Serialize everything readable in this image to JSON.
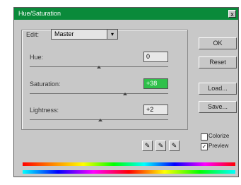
{
  "window": {
    "title": "Hue/Saturation",
    "close_label": "x"
  },
  "edit": {
    "label": "Edit:",
    "value": "Master",
    "arrow": "▾"
  },
  "sliders": [
    {
      "label": "Hue:",
      "value": "0",
      "level": 0.5
    },
    {
      "label": "Saturation:",
      "value": "+38",
      "level": 0.69
    },
    {
      "label": "Lightness:",
      "value": "+2",
      "level": 0.51
    }
  ],
  "buttons": {
    "ok": "OK",
    "reset": "Reset",
    "load": "Load...",
    "save": "Save..."
  },
  "eyedroppers": [
    "eyedropper-icon",
    "eyedropper-plus-icon",
    "eyedropper-minus-icon"
  ],
  "checkboxes": {
    "colorize_label": "Colorize",
    "colorize_checked": false,
    "preview_label": "Preview",
    "preview_checked": true
  }
}
